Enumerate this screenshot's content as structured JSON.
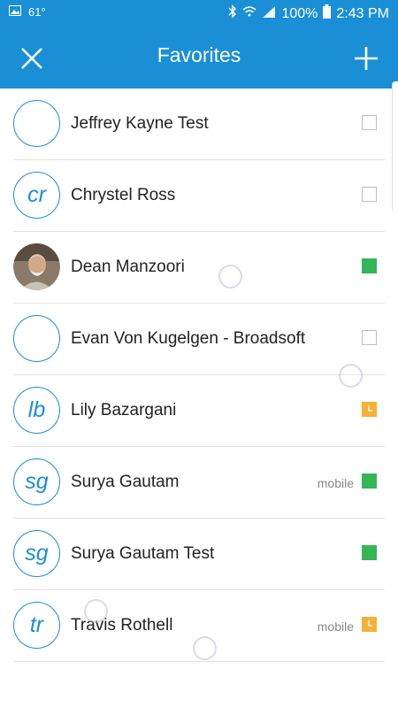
{
  "status_bar": {
    "temperature": "61°",
    "battery": "100%",
    "time": "2:43 PM",
    "icons": [
      "image-icon",
      "bluetooth-icon",
      "wifi-icon",
      "signal-icon",
      "battery-icon"
    ]
  },
  "header": {
    "title": "Favorites",
    "close_icon": "close-icon",
    "add_icon": "add-icon",
    "background": "#1a8fd6"
  },
  "favorites": [
    {
      "initials": "",
      "name": "Jeffrey Kayne Test",
      "meta": "",
      "presence": "offline",
      "photo": false
    },
    {
      "initials": "cr",
      "name": "Chrystel Ross",
      "meta": "",
      "presence": "offline",
      "photo": false
    },
    {
      "initials": "",
      "name": "Dean Manzoori",
      "meta": "",
      "presence": "available",
      "photo": true
    },
    {
      "initials": "",
      "name": "Evan Von Kugelgen - Broadsoft",
      "meta": "",
      "presence": "offline",
      "photo": false
    },
    {
      "initials": "lb",
      "name": "Lily Bazargani",
      "meta": "",
      "presence": "away",
      "photo": false
    },
    {
      "initials": "sg",
      "name": "Surya Gautam",
      "meta": "mobile",
      "presence": "available",
      "photo": false
    },
    {
      "initials": "sg",
      "name": "Surya Gautam Test",
      "meta": "",
      "presence": "available",
      "photo": false
    },
    {
      "initials": "tr",
      "name": "Travis Rothell",
      "meta": "mobile",
      "presence": "away",
      "photo": false
    }
  ],
  "colors": {
    "accent": "#1a8fd6",
    "available": "#34b556",
    "away": "#f4b13a"
  }
}
